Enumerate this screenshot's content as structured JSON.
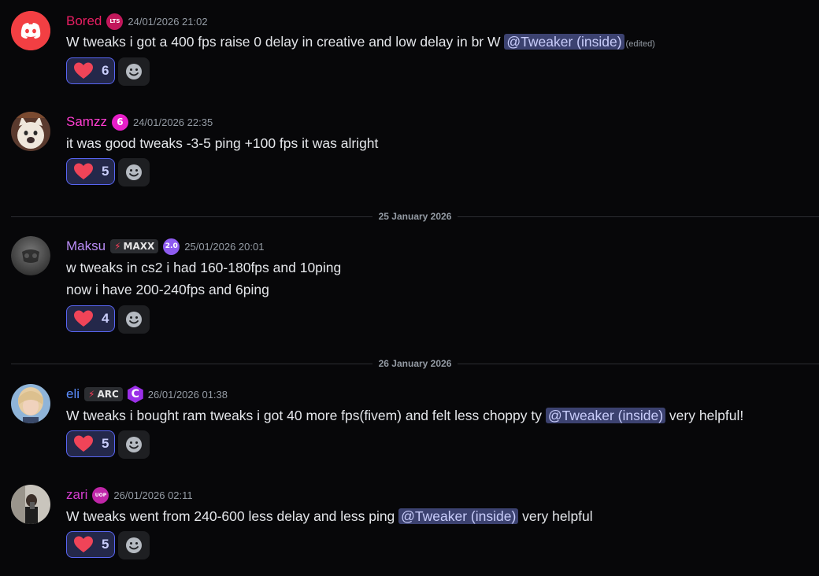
{
  "messages": [
    {
      "username": "Bored",
      "username_color": "#e91e63",
      "badge_text": "LTS",
      "timestamp": "24/01/2026 21:02",
      "lines": [
        {
          "before": "W tweaks i got a 400 fps raise 0 delay in creative and low delay in br W ",
          "mention": "@Tweaker (inside)",
          "after": "",
          "edited": "(edited)"
        }
      ],
      "reaction_emoji": "heart-emoji",
      "reaction_count": "6"
    },
    {
      "username": "Samzz",
      "username_color": "#ff3dd0",
      "badge_text": "6",
      "timestamp": "24/01/2026 22:35",
      "lines": [
        {
          "before": "it was good tweaks -3-5 ping +100 fps it was alright"
        }
      ],
      "reaction_emoji": "heart-emoji",
      "reaction_count": "5"
    },
    {
      "username": "Maksu",
      "username_color": "#b98cf5",
      "tag_text": "MAXX",
      "badge_text": "2.0",
      "timestamp": "25/01/2026 20:01",
      "lines": [
        {
          "before": "w tweaks in cs2 i had 160-180fps and 10ping"
        },
        {
          "before": "now i have 200-240fps and 6ping"
        }
      ],
      "reaction_emoji": "heart-emoji",
      "reaction_count": "4"
    },
    {
      "username": "eli",
      "username_color": "#5b8dff",
      "tag_text": "ARC",
      "badge_text": "C",
      "timestamp": "26/01/2026 01:38",
      "lines": [
        {
          "before": "W tweaks i bought ram tweaks i got 40 more fps(fivem) and felt less choppy ty ",
          "mention": "@Tweaker (inside)",
          "after": " very helpful!"
        }
      ],
      "reaction_emoji": "heart-emoji",
      "reaction_count": "5"
    },
    {
      "username": "zari",
      "username_color": "#d63dd0",
      "badge_text": "UOP",
      "timestamp": "26/01/2026 02:11",
      "lines": [
        {
          "before": "W tweaks went from 240-600 less delay and less ping ",
          "mention": "@Tweaker (inside)",
          "after": " very helpful"
        }
      ],
      "reaction_emoji": "heart-emoji",
      "reaction_count": "5"
    }
  ],
  "dividers": [
    "25 January 2026",
    "26 January 2026"
  ],
  "colors": {
    "background": "#070709",
    "mention_bg": "#3c4270",
    "reaction_border": "#5865f2"
  }
}
